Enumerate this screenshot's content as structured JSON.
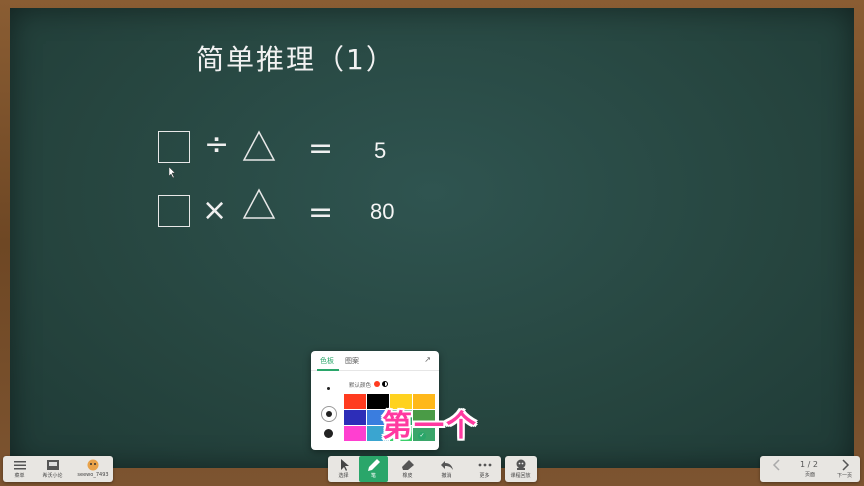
{
  "board": {
    "title": "简单推理（1）",
    "equations": [
      {
        "operator": "÷",
        "equals": "=",
        "result": "5"
      },
      {
        "operator": "×",
        "equals": "=",
        "result": "80"
      }
    ]
  },
  "palette": {
    "tabs": [
      "色板",
      "图案"
    ],
    "default_color_label": "默认颜色",
    "swatch_colors": [
      "#ff3b1f",
      "#000000",
      "#ffd21f",
      "#ffb81a",
      "#2d2db8",
      "#3a7ddf",
      "#2aa66a",
      "#4a9b46",
      "#ff3fd0",
      "#3aa5d0",
      "#3bcf6a",
      "#3aa66a"
    ]
  },
  "overlay": {
    "caption": "第一个"
  },
  "toolbar": {
    "left": [
      {
        "label": "菜单",
        "icon": "menu-icon"
      },
      {
        "label": "希沃小论",
        "icon": "window-icon"
      },
      {
        "label": "seewo_7493",
        "icon": "avatar-icon"
      }
    ],
    "center": [
      {
        "label": "选择",
        "icon": "cursor-icon"
      },
      {
        "label": "笔",
        "icon": "pen-icon"
      },
      {
        "label": "橡皮",
        "icon": "eraser-icon"
      },
      {
        "label": "撤消",
        "icon": "undo-icon"
      },
      {
        "label": "更多",
        "icon": "more-icon"
      }
    ],
    "lesson": {
      "label": "课程回放",
      "icon": "replay-icon"
    },
    "pager": {
      "prev_label": "页面",
      "page_text": "1 / 2",
      "next_label": "下一页"
    }
  },
  "colors": {
    "accent": "#2aa66a",
    "board": "#26453f",
    "frame": "#6e4724"
  }
}
